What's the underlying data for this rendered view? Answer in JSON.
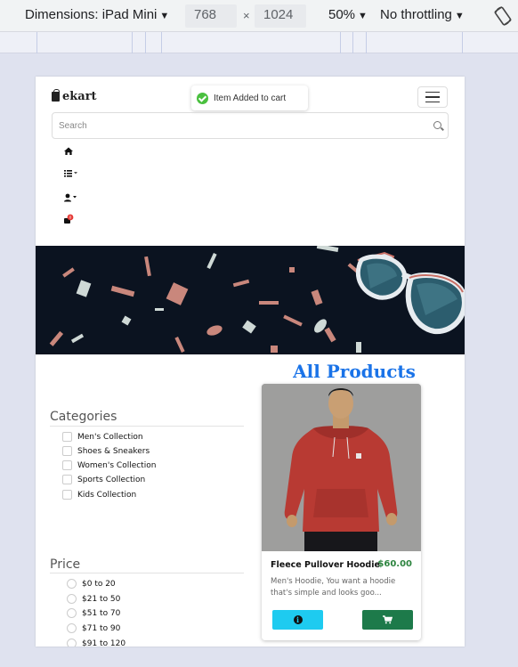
{
  "devtools": {
    "dimensions_label": "Dimensions: iPad Mini",
    "width": "768",
    "times": "×",
    "height": "1024",
    "zoom": "50%",
    "throttling": "No throttling",
    "rotate_icon": "rotate-device-icon"
  },
  "site": {
    "brand": "ekart",
    "toast": "Item Added to cart",
    "search_placeholder": "Search",
    "nav_icons": [
      "home-icon",
      "list-icon",
      "user-icon",
      "cart-icon"
    ],
    "cart_count": "0",
    "section_title": "All Products",
    "categories": {
      "title": "Categories",
      "items": [
        "Men's Collection",
        "Shoes & Sneakers",
        "Women's Collection",
        "Sports Collection",
        "Kids Collection"
      ]
    },
    "price": {
      "title": "Price",
      "items": [
        "$0 to 20",
        "$21 to 50",
        "$51 to 70",
        "$71 to 90",
        "$91 to 120"
      ]
    },
    "product": {
      "name": "Fleece Pullover Hoodie",
      "price": "$60.00",
      "description": "Men's Hoodie, You want a hoodie that's simple and looks goo...",
      "info_icon": "info-icon",
      "cart_icon": "cart-icon"
    }
  },
  "colors": {
    "accent_blue": "#1a73e8",
    "price_green": "#2e8540",
    "info_button": "#1ecbf0",
    "cart_button": "#1d7a4a",
    "banner_bg": "#0b1320"
  }
}
